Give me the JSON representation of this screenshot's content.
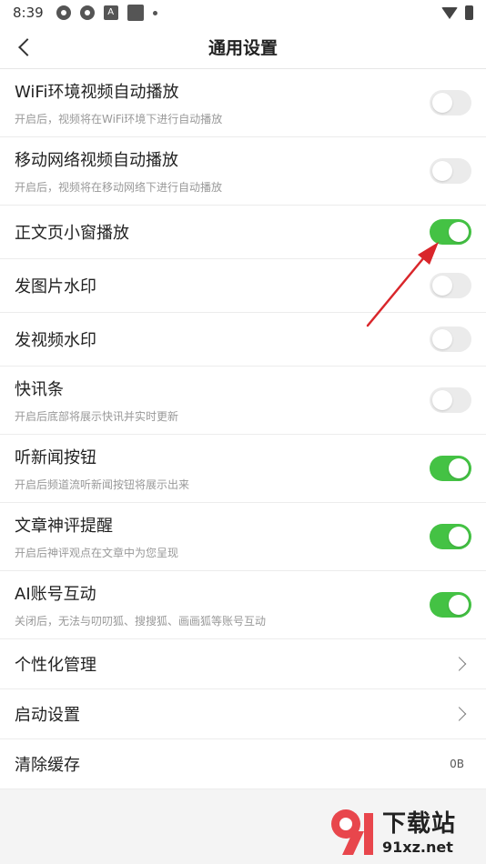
{
  "status_bar": {
    "time": "8:39",
    "icon_a": "A"
  },
  "header": {
    "title": "通用设置"
  },
  "settings": [
    {
      "title": "WiFi环境视频自动播放",
      "subtitle": "开启后，视频将在WiFi环境下进行自动播放",
      "toggle": false
    },
    {
      "title": "移动网络视频自动播放",
      "subtitle": "开启后，视频将在移动网络下进行自动播放",
      "toggle": false
    },
    {
      "title": "正文页小窗播放",
      "subtitle": "",
      "toggle": true
    },
    {
      "title": "发图片水印",
      "subtitle": "",
      "toggle": false
    },
    {
      "title": "发视频水印",
      "subtitle": "",
      "toggle": false
    },
    {
      "title": "快讯条",
      "subtitle": "开启后底部将展示快讯并实时更新",
      "toggle": false
    },
    {
      "title": "听新闻按钮",
      "subtitle": "开启后频道流听新闻按钮将展示出来",
      "toggle": true
    },
    {
      "title": "文章神评提醒",
      "subtitle": "开启后神评观点在文章中为您呈现",
      "toggle": true
    },
    {
      "title": "AI账号互动",
      "subtitle": "关闭后，无法与叨叨狐、搜搜狐、画画狐等账号互动",
      "toggle": true
    }
  ],
  "nav_items": [
    {
      "title": "个性化管理"
    },
    {
      "title": "启动设置"
    }
  ],
  "cache": {
    "title": "清除缓存",
    "value": "0B"
  },
  "watermark": {
    "title": "下载站",
    "url": "91xz.net"
  },
  "colors": {
    "toggle_on": "#44c244",
    "toggle_off": "#ebebeb",
    "arrow": "#d9262b"
  }
}
